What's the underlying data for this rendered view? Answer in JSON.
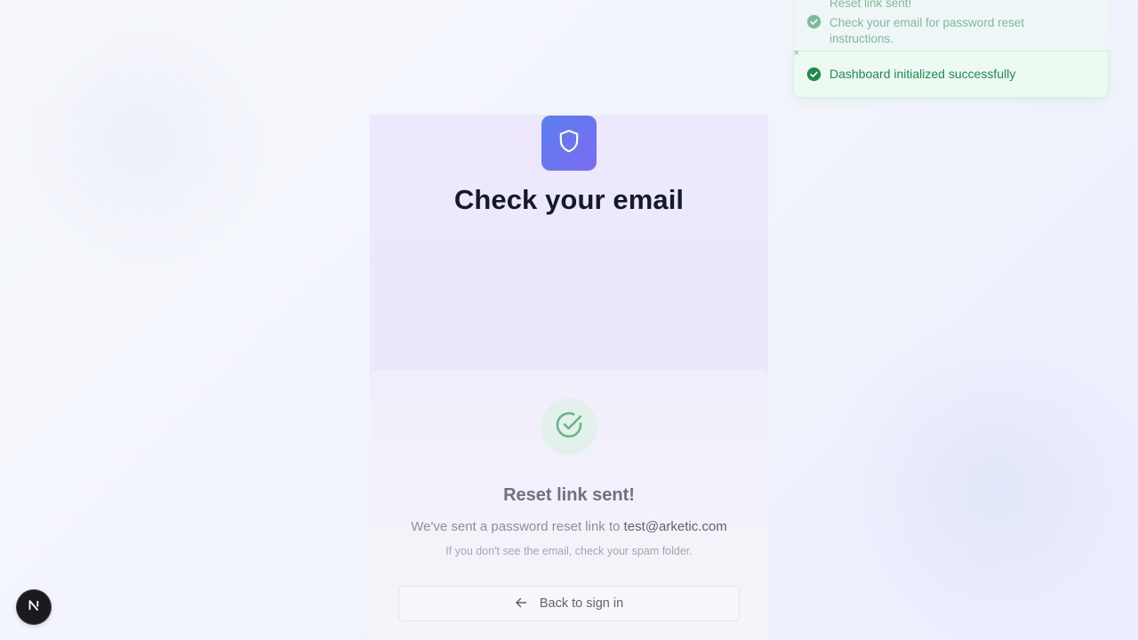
{
  "auth": {
    "title": "Check your email",
    "card": {
      "heading": "Reset link sent!",
      "message_prefix": "We've sent a password reset link to",
      "email": "test@arketic.com",
      "hint": "If you don't see the email, check your spam folder.",
      "back_button_label": "Back to sign in"
    }
  },
  "toasts": [
    {
      "title": "Reset link sent!",
      "description": "Check your email for password reset instructions.",
      "status": "success"
    },
    {
      "title": "Dashboard initialized successfully",
      "status": "success"
    }
  ],
  "toast_close_glyph": "×",
  "dev_badge_letter": "N",
  "icons": {
    "logo": "shield-icon",
    "success": "check-circle-icon",
    "back": "arrow-left-icon",
    "toast": "check-circle-filled-icon"
  },
  "colors": {
    "brand_gradient_start": "#5b7ff0",
    "brand_gradient_end": "#7b6cf0",
    "success": "#1f8a4c",
    "success_soft": "#e3f1ec"
  }
}
